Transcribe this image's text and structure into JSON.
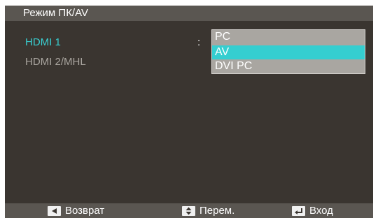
{
  "title": "Режим ПК/AV",
  "menu": {
    "items": [
      {
        "label": "HDMI 1",
        "state": "active"
      },
      {
        "label": "HDMI 2/MHL",
        "state": "inactive"
      }
    ],
    "separator": ":"
  },
  "dropdown": {
    "options": [
      "PC",
      "AV",
      "DVI PC"
    ],
    "selected": "AV"
  },
  "footer": {
    "hints": [
      {
        "icon": "arrow-left-icon",
        "label": "Возврат"
      },
      {
        "icon": "arrow-up-down-icon",
        "label": "Перем."
      },
      {
        "icon": "enter-icon",
        "label": "Вход"
      }
    ]
  },
  "colors": {
    "background": "#3a3530",
    "bar": "#5a5651",
    "accent": "#39cfd1",
    "dropdown": "#a9a6a1",
    "inactive_text": "#a8a49e"
  }
}
